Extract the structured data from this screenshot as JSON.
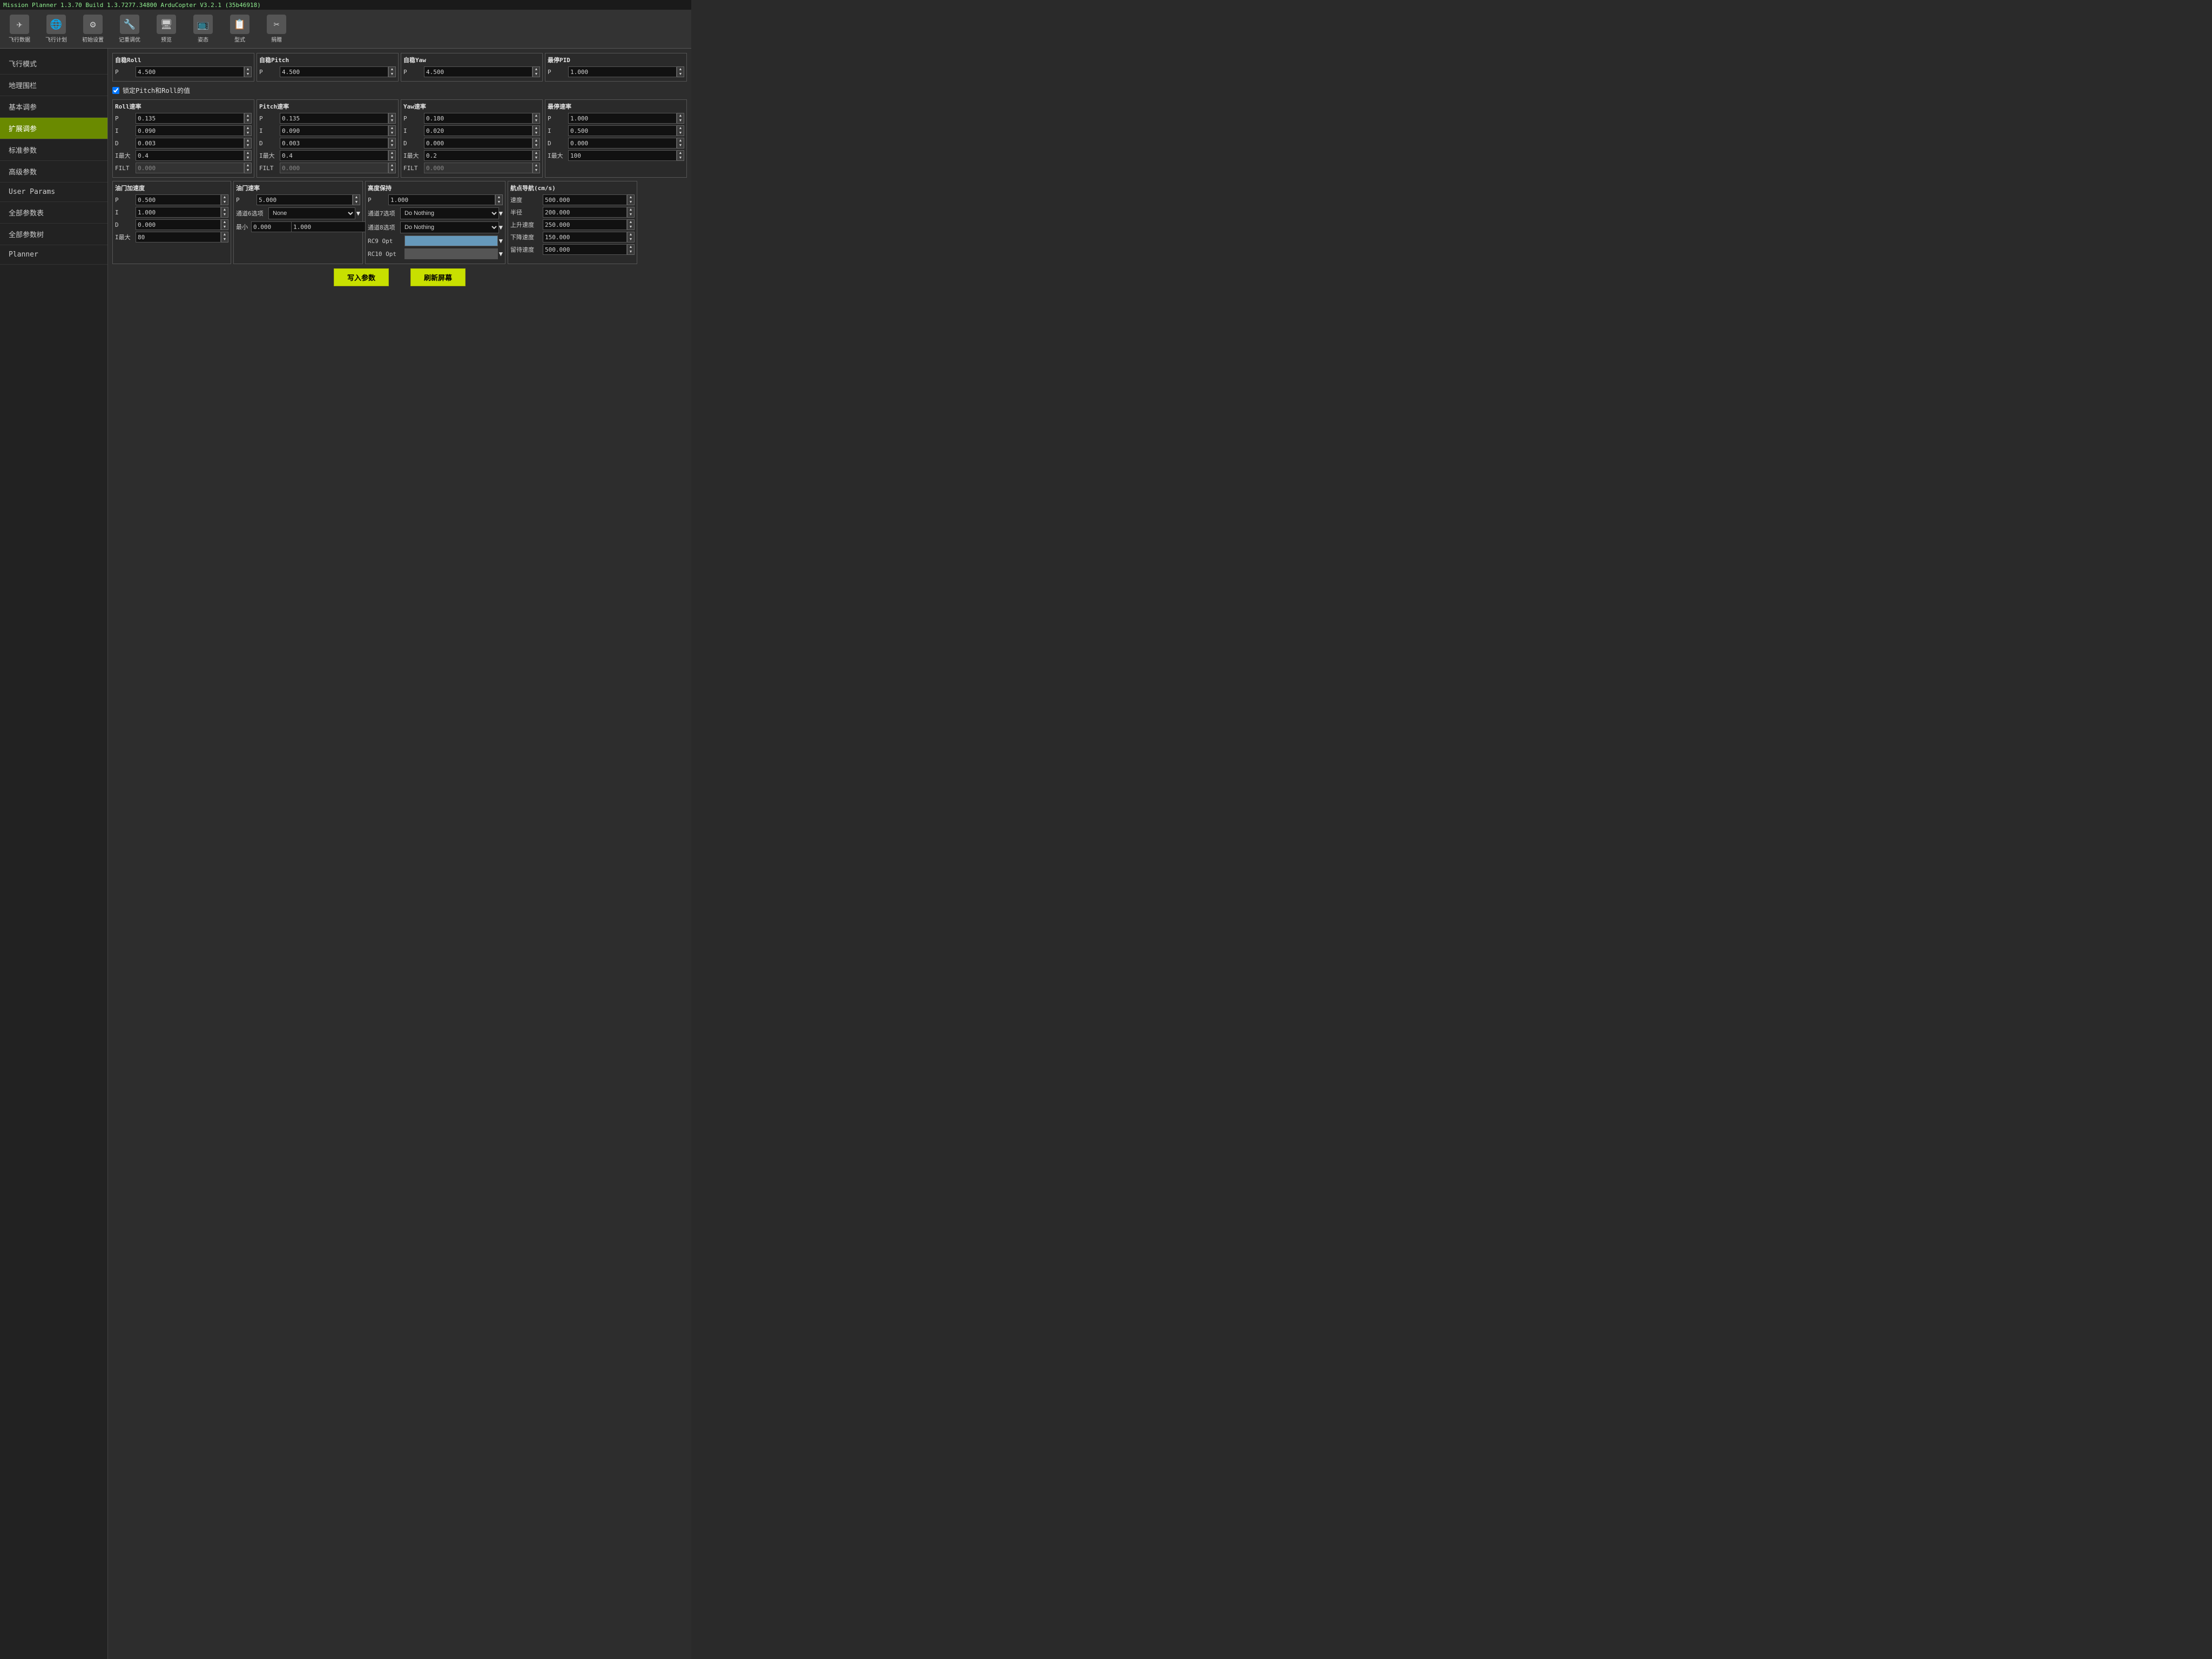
{
  "titlebar": {
    "text": "Mission Planner 1.3.70 Build 1.3.7277.34800 ArduCopter V3.2.1 (35b46918)"
  },
  "toolbar": {
    "items": [
      {
        "label": "飞行数据",
        "icon": "✈"
      },
      {
        "label": "飞行计划",
        "icon": "🌐"
      },
      {
        "label": "初始设置",
        "icon": "⚙"
      },
      {
        "label": "记重调优",
        "icon": "🔧"
      },
      {
        "label": "预览",
        "icon": "🖥"
      },
      {
        "label": "姿态",
        "icon": "📺"
      },
      {
        "label": "型式",
        "icon": "📋"
      },
      {
        "label": "捐赠",
        "icon": "✂"
      }
    ]
  },
  "sidebar": {
    "items": [
      {
        "label": "飞行模式",
        "active": false
      },
      {
        "label": "地理围栏",
        "active": false
      },
      {
        "label": "基本调参",
        "active": false
      },
      {
        "label": "扩展调参",
        "active": true
      },
      {
        "label": "标准参数",
        "active": false
      },
      {
        "label": "高级参数",
        "active": false
      },
      {
        "label": "User Params",
        "active": false
      },
      {
        "label": "全部参数表",
        "active": false
      },
      {
        "label": "全部参数树",
        "active": false
      },
      {
        "label": "Planner",
        "active": false
      }
    ]
  },
  "panels": {
    "auto_roll": {
      "title": "自稳Roll",
      "fields": [
        {
          "label": "P",
          "value": "4.500"
        }
      ]
    },
    "auto_pitch": {
      "title": "自稳Pitch",
      "fields": [
        {
          "label": "P",
          "value": "4.500"
        }
      ]
    },
    "auto_yaw": {
      "title": "自稳Yaw",
      "fields": [
        {
          "label": "P",
          "value": "4.500"
        }
      ]
    },
    "stop_pid": {
      "title": "最停PID",
      "fields": [
        {
          "label": "P",
          "value": "1.000"
        }
      ]
    },
    "lock_pitch_roll": {
      "label": "✓ 锁定Pitch和Roll的值",
      "checked": true
    },
    "roll_rate": {
      "title": "Roll速率",
      "fields": [
        {
          "label": "P",
          "value": "0.135"
        },
        {
          "label": "I",
          "value": "0.090"
        },
        {
          "label": "D",
          "value": "0.003"
        },
        {
          "label": "I最大",
          "value": "0.4"
        },
        {
          "label": "FILT",
          "value": "0.000"
        }
      ]
    },
    "pitch_rate": {
      "title": "Pitch速率",
      "fields": [
        {
          "label": "P",
          "value": "0.135"
        },
        {
          "label": "I",
          "value": "0.090"
        },
        {
          "label": "D",
          "value": "0.003"
        },
        {
          "label": "I最大",
          "value": "0.4"
        },
        {
          "label": "FILT",
          "value": "0.000"
        }
      ]
    },
    "yaw_rate": {
      "title": "Yaw速率",
      "fields": [
        {
          "label": "P",
          "value": "0.180"
        },
        {
          "label": "I",
          "value": "0.020"
        },
        {
          "label": "D",
          "value": "0.000"
        },
        {
          "label": "I最大",
          "value": "0.2"
        },
        {
          "label": "FILT",
          "value": "0.000"
        }
      ]
    },
    "stop_rate": {
      "title": "最停速率",
      "fields": [
        {
          "label": "P",
          "value": "1.000"
        },
        {
          "label": "I",
          "value": "0.500"
        },
        {
          "label": "D",
          "value": "0.000"
        },
        {
          "label": "I最大",
          "value": "100"
        }
      ]
    },
    "throttle_accel": {
      "title": "油门加速度",
      "fields": [
        {
          "label": "P",
          "value": "0.500"
        },
        {
          "label": "I",
          "value": "1.000"
        },
        {
          "label": "D",
          "value": "0.000"
        },
        {
          "label": "I最大",
          "value": "80"
        }
      ]
    },
    "throttle_rate": {
      "title": "油门速率",
      "fields": [
        {
          "label": "P",
          "value": "5.000"
        }
      ],
      "ch6_label": "通道6选项",
      "ch6_value": "None",
      "min_label": "最小",
      "min_value": "0.000",
      "max_value": "1.000"
    },
    "alt_hold": {
      "title": "高度保持",
      "fields": [
        {
          "label": "P",
          "value": "1.000"
        }
      ],
      "ch7_label": "通道7选项",
      "ch7_value": "Do Nothing",
      "ch8_label": "通道8选项",
      "ch8_value": "Do Nothing",
      "rc9_label": "RC9 Opt",
      "rc10_label": "RC10 Opt"
    },
    "nav": {
      "title": "航点导航(cm/s)",
      "fields": [
        {
          "label": "速度",
          "value": "500.000"
        },
        {
          "label": "半径",
          "value": "200.000"
        },
        {
          "label": "上升速度",
          "value": "250.000"
        },
        {
          "label": "下降速度",
          "value": "150.000"
        },
        {
          "label": "留待速度",
          "value": "500.000"
        }
      ]
    }
  },
  "buttons": {
    "write_params": "写入参数",
    "refresh_screen": "刷新屏幕"
  }
}
